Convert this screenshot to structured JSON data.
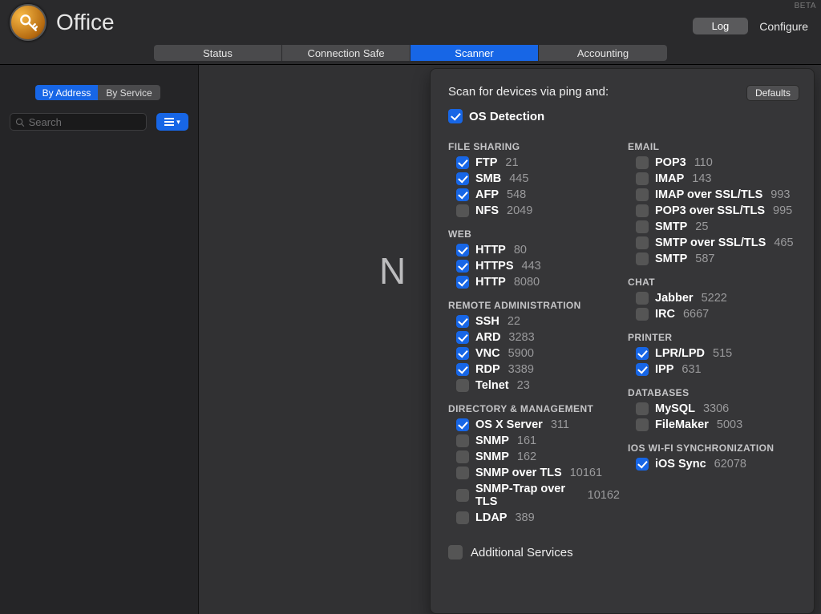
{
  "header": {
    "app_title": "Office",
    "beta": "BETA",
    "log": "Log",
    "configure": "Configure"
  },
  "tabs": {
    "items": [
      "Status",
      "Connection Safe",
      "Scanner",
      "Accounting"
    ],
    "active": 2
  },
  "sidebar": {
    "seg": {
      "by_address": "By Address",
      "by_service": "By Service"
    },
    "search_placeholder": "Search"
  },
  "main": {
    "bg_text": "N"
  },
  "panel": {
    "title": "Scan for devices via ping and:",
    "defaults": "Defaults",
    "os_detection": {
      "label": "OS Detection",
      "checked": true
    },
    "additional": {
      "label": "Additional Services",
      "checked": false
    },
    "left": [
      {
        "cat": "FILE SHARING",
        "items": [
          {
            "label": "FTP",
            "port": "21",
            "checked": true
          },
          {
            "label": "SMB",
            "port": "445",
            "checked": true
          },
          {
            "label": "AFP",
            "port": "548",
            "checked": true
          },
          {
            "label": "NFS",
            "port": "2049",
            "checked": false
          }
        ]
      },
      {
        "cat": "WEB",
        "items": [
          {
            "label": "HTTP",
            "port": "80",
            "checked": true
          },
          {
            "label": "HTTPS",
            "port": "443",
            "checked": true
          },
          {
            "label": "HTTP",
            "port": "8080",
            "checked": true
          }
        ]
      },
      {
        "cat": "REMOTE ADMINISTRATION",
        "items": [
          {
            "label": "SSH",
            "port": "22",
            "checked": true
          },
          {
            "label": "ARD",
            "port": "3283",
            "checked": true
          },
          {
            "label": "VNC",
            "port": "5900",
            "checked": true
          },
          {
            "label": "RDP",
            "port": "3389",
            "checked": true
          },
          {
            "label": "Telnet",
            "port": "23",
            "checked": false
          }
        ]
      },
      {
        "cat": "DIRECTORY & MANAGEMENT",
        "items": [
          {
            "label": "OS X Server",
            "port": "311",
            "checked": true
          },
          {
            "label": "SNMP",
            "port": "161",
            "checked": false
          },
          {
            "label": "SNMP",
            "port": "162",
            "checked": false
          },
          {
            "label": "SNMP over TLS",
            "port": "10161",
            "checked": false
          },
          {
            "label": "SNMP-Trap over TLS",
            "port": "10162",
            "checked": false
          },
          {
            "label": "LDAP",
            "port": "389",
            "checked": false
          }
        ]
      }
    ],
    "right": [
      {
        "cat": "EMAIL",
        "items": [
          {
            "label": "POP3",
            "port": "110",
            "checked": false
          },
          {
            "label": "IMAP",
            "port": "143",
            "checked": false
          },
          {
            "label": "IMAP over SSL/TLS",
            "port": "993",
            "checked": false
          },
          {
            "label": "POP3 over SSL/TLS",
            "port": "995",
            "checked": false
          },
          {
            "label": "SMTP",
            "port": "25",
            "checked": false
          },
          {
            "label": "SMTP over SSL/TLS",
            "port": "465",
            "checked": false
          },
          {
            "label": "SMTP",
            "port": "587",
            "checked": false
          }
        ]
      },
      {
        "cat": "CHAT",
        "items": [
          {
            "label": "Jabber",
            "port": "5222",
            "checked": false
          },
          {
            "label": "IRC",
            "port": "6667",
            "checked": false
          }
        ]
      },
      {
        "cat": "PRINTER",
        "items": [
          {
            "label": "LPR/LPD",
            "port": "515",
            "checked": true
          },
          {
            "label": "IPP",
            "port": "631",
            "checked": true
          }
        ]
      },
      {
        "cat": "DATABASES",
        "items": [
          {
            "label": "MySQL",
            "port": "3306",
            "checked": false
          },
          {
            "label": "FileMaker",
            "port": "5003",
            "checked": false
          }
        ]
      },
      {
        "cat": "IOS WI-FI SYNCHRONIZATION",
        "items": [
          {
            "label": "iOS Sync",
            "port": "62078",
            "checked": true
          }
        ]
      }
    ]
  }
}
